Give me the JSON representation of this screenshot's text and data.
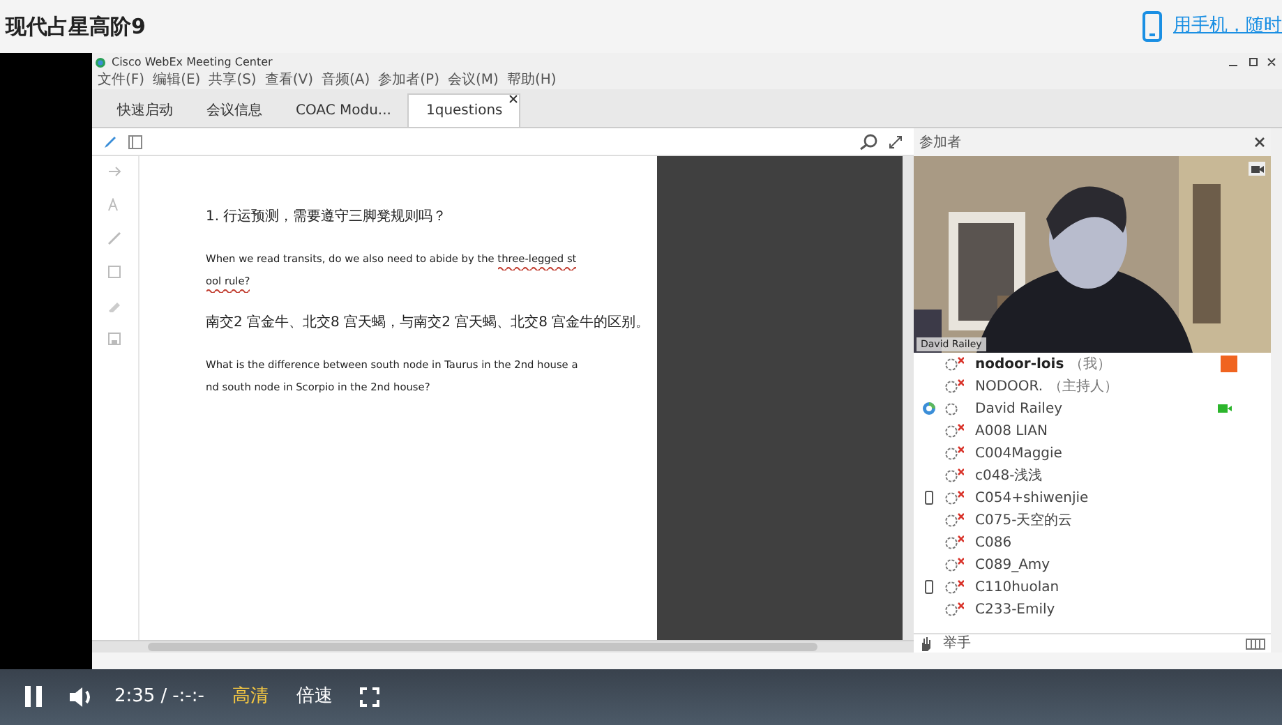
{
  "page": {
    "title": "现代占星高阶9",
    "mobile_link": "用手机，随时"
  },
  "webex": {
    "title": "Cisco WebEx Meeting Center",
    "menu": [
      "文件(F)",
      "编辑(E)",
      "共享(S)",
      "查看(V)",
      "音频(A)",
      "参加者(P)",
      "会议(M)",
      "帮助(H)"
    ],
    "tabs": [
      {
        "label": "快速启动",
        "selected": false,
        "closable": false
      },
      {
        "label": "会议信息",
        "selected": false,
        "closable": false
      },
      {
        "label": "COAC Modu...",
        "selected": false,
        "closable": false
      },
      {
        "label": "1questions",
        "selected": true,
        "closable": true
      }
    ],
    "document": [
      {
        "lines": [
          {
            "parts": [
              {
                "text": "1. 行运预测，需要遵守三脚凳规则吗？",
                "flagged": false
              }
            ]
          }
        ]
      },
      {
        "lines": [
          {
            "parts": [
              {
                "text": "When we read transits, do we also need to abide by the ",
                "flagged": false
              },
              {
                "text": "three-legged st",
                "flagged": true
              }
            ]
          },
          {
            "parts": [
              {
                "text": "ool rule?",
                "flagged": true
              }
            ]
          }
        ]
      },
      {
        "lines": [
          {
            "parts": [
              {
                "text": "南交2 宫金牛、北交8 宫天蝎，与南交2 宫天蝎、北交8 宫金牛的区别。",
                "flagged": false
              }
            ]
          }
        ]
      },
      {
        "lines": [
          {
            "parts": [
              {
                "text": "What is the difference between south node in Taurus in the 2nd house a",
                "flagged": false
              }
            ]
          },
          {
            "parts": [
              {
                "text": "nd south node in Scorpio in the 2nd house?",
                "flagged": false
              }
            ]
          }
        ]
      }
    ],
    "participants_panel": {
      "title": "参加者",
      "video_name": "David Railey",
      "raise_hand": "举手",
      "participants": [
        {
          "name": "nodoor-lois",
          "tag": "（我）",
          "me": true,
          "muted": true,
          "phone": false,
          "presenter": false,
          "camera": false,
          "mic_button": true
        },
        {
          "name": "NODOOR.",
          "tag": "（主持人）",
          "me": false,
          "muted": true,
          "phone": false,
          "presenter": false,
          "camera": false,
          "mic_button": false
        },
        {
          "name": "David Railey",
          "me": false,
          "muted": false,
          "phone": false,
          "presenter": true,
          "camera": true,
          "mic_button": false
        },
        {
          "name": "A008 LIAN",
          "me": false,
          "muted": true,
          "phone": false,
          "presenter": false,
          "camera": false,
          "mic_button": false
        },
        {
          "name": "C004Maggie",
          "me": false,
          "muted": true,
          "phone": false,
          "presenter": false,
          "camera": false,
          "mic_button": false
        },
        {
          "name": "c048-浅浅",
          "me": false,
          "muted": true,
          "phone": false,
          "presenter": false,
          "camera": false,
          "mic_button": false
        },
        {
          "name": "C054+shiwenjie",
          "me": false,
          "muted": true,
          "phone": true,
          "presenter": false,
          "camera": false,
          "mic_button": false
        },
        {
          "name": "C075-天空的云",
          "me": false,
          "muted": true,
          "phone": false,
          "presenter": false,
          "camera": false,
          "mic_button": false
        },
        {
          "name": "C086",
          "me": false,
          "muted": true,
          "phone": false,
          "presenter": false,
          "camera": false,
          "mic_button": false
        },
        {
          "name": "C089_Amy",
          "me": false,
          "muted": true,
          "phone": false,
          "presenter": false,
          "camera": false,
          "mic_button": false
        },
        {
          "name": "C110huolan",
          "me": false,
          "muted": true,
          "phone": true,
          "presenter": false,
          "camera": false,
          "mic_button": false
        },
        {
          "name": "C233-Emily",
          "me": false,
          "muted": true,
          "phone": false,
          "presenter": false,
          "camera": false,
          "mic_button": false
        }
      ]
    }
  },
  "player": {
    "playing": true,
    "time": "2:35",
    "separator": "/",
    "duration": "-:-:-",
    "quality": "高清",
    "speed": "倍速"
  }
}
